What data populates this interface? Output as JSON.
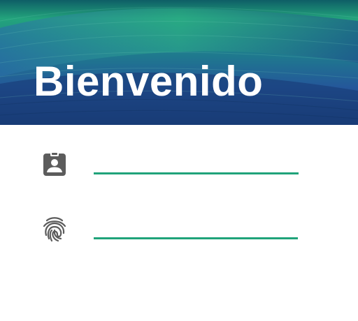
{
  "header": {
    "title": "Bienvenido",
    "background": "ocean-wave-image"
  },
  "form": {
    "username": {
      "icon": "contact-badge-icon",
      "value": "",
      "placeholder": ""
    },
    "password": {
      "icon": "fingerprint-icon",
      "value": "",
      "placeholder": ""
    }
  },
  "colors": {
    "accent": "#20a37a",
    "icon": "#5c5c5c",
    "header_text": "#ffffff"
  }
}
